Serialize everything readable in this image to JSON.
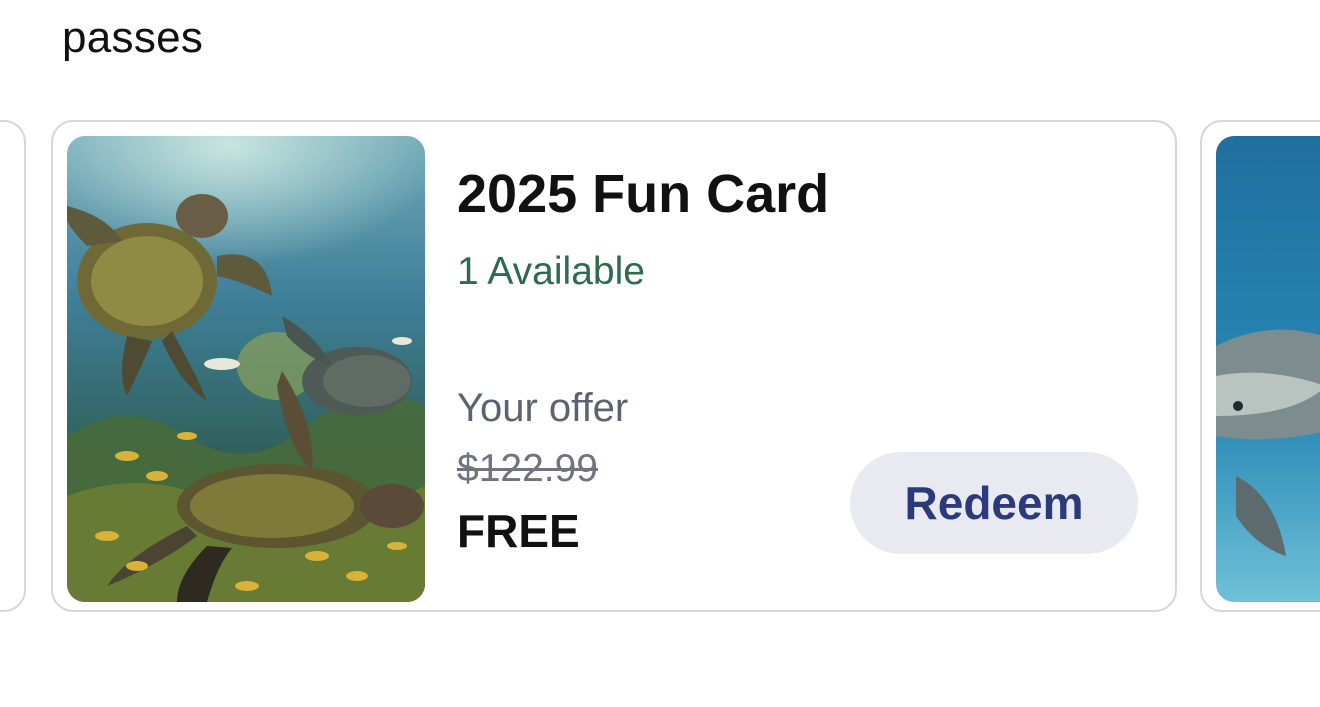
{
  "section": {
    "title": "passes"
  },
  "card": {
    "title": "2025 Fun Card",
    "availability": "1 Available",
    "offer_label": "Your offer",
    "original_price": "$122.99",
    "final_price": "FREE",
    "redeem_label": "Redeem",
    "image_subject": "sea turtles swimming underwater with fish",
    "availability_color": "#2f6a4f",
    "button_text_color": "#2b3a7a",
    "button_background": "#e9eaf1"
  },
  "next_card": {
    "image_subject": "dolphin swimming underwater"
  }
}
